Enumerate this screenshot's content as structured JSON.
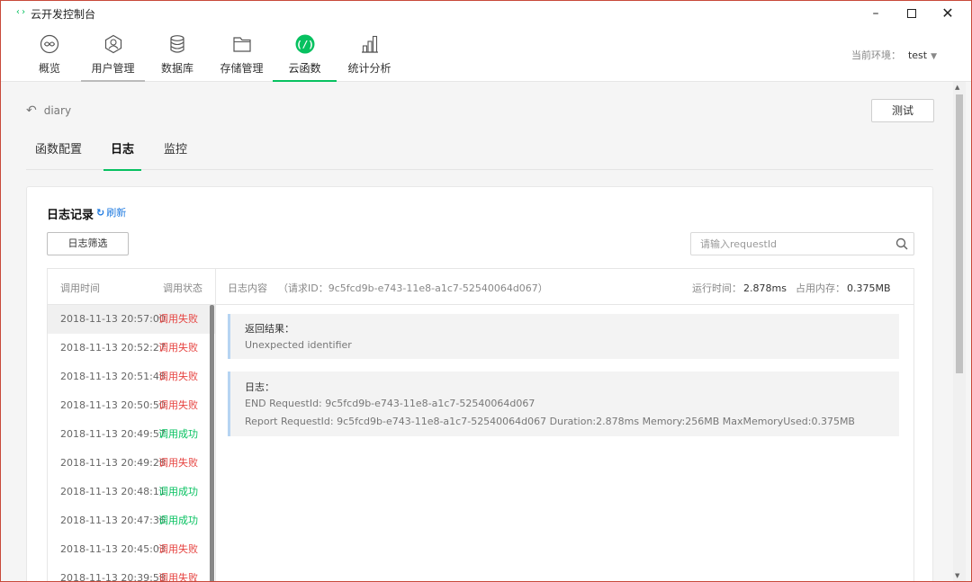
{
  "window": {
    "title": "云开发控制台",
    "app_icon": "‹›",
    "minimize": "–",
    "close": "✕"
  },
  "toolbar": {
    "items": [
      {
        "label": "概览",
        "icon": "overview-icon"
      },
      {
        "label": "用户管理",
        "icon": "user-icon"
      },
      {
        "label": "数据库",
        "icon": "database-icon"
      },
      {
        "label": "存储管理",
        "icon": "folder-icon"
      },
      {
        "label": "云函数",
        "icon": "cloud-function-icon"
      },
      {
        "label": "统计分析",
        "icon": "chart-icon"
      }
    ],
    "active_index": 4,
    "env_label": "当前环境：",
    "env_value": "test"
  },
  "page": {
    "breadcrumb": "diary",
    "test_button": "测试",
    "tabs": [
      "函数配置",
      "日志",
      "监控"
    ],
    "active_tab": 1
  },
  "log_card": {
    "title": "日志记录",
    "refresh": "刷新",
    "filter_button": "日志筛选",
    "search_placeholder": "请输入requestId",
    "header": {
      "time": "调用时间",
      "status": "调用状态",
      "content": "日志内容",
      "request_id": "（请求ID：9c5fcd9b-e743-11e8-a1c7-52540064d067）",
      "runtime_label": "运行时间：",
      "runtime_value": "2.878ms",
      "memory_label": "占用内存：",
      "memory_value": "0.375MB"
    },
    "rows": [
      {
        "time": "2018-11-13 20:57:00",
        "status": "调用失败",
        "ok": false
      },
      {
        "time": "2018-11-13 20:52:27",
        "status": "调用失败",
        "ok": false
      },
      {
        "time": "2018-11-13 20:51:48",
        "status": "调用失败",
        "ok": false
      },
      {
        "time": "2018-11-13 20:50:50",
        "status": "调用失败",
        "ok": false
      },
      {
        "time": "2018-11-13 20:49:57",
        "status": "调用成功",
        "ok": true
      },
      {
        "time": "2018-11-13 20:49:28",
        "status": "调用失败",
        "ok": false
      },
      {
        "time": "2018-11-13 20:48:11",
        "status": "调用成功",
        "ok": true
      },
      {
        "time": "2018-11-13 20:47:36",
        "status": "调用成功",
        "ok": true
      },
      {
        "time": "2018-11-13 20:45:03",
        "status": "调用失败",
        "ok": false
      },
      {
        "time": "2018-11-13 20:39:58",
        "status": "调用失败",
        "ok": false
      }
    ],
    "result_block": {
      "title": "返回结果：",
      "lines": [
        "Unexpected identifier"
      ]
    },
    "log_block": {
      "title": "日志：",
      "lines": [
        "END RequestId: 9c5fcd9b-e743-11e8-a1c7-52540064d067",
        "Report RequestId: 9c5fcd9b-e743-11e8-a1c7-52540064d067 Duration:2.878ms Memory:256MB MaxMemoryUsed:0.375MB"
      ]
    }
  },
  "colors": {
    "accent": "#07c160",
    "fail": "#e64340",
    "link": "#1e7ae0",
    "log_bar": "#b6d4f2"
  }
}
